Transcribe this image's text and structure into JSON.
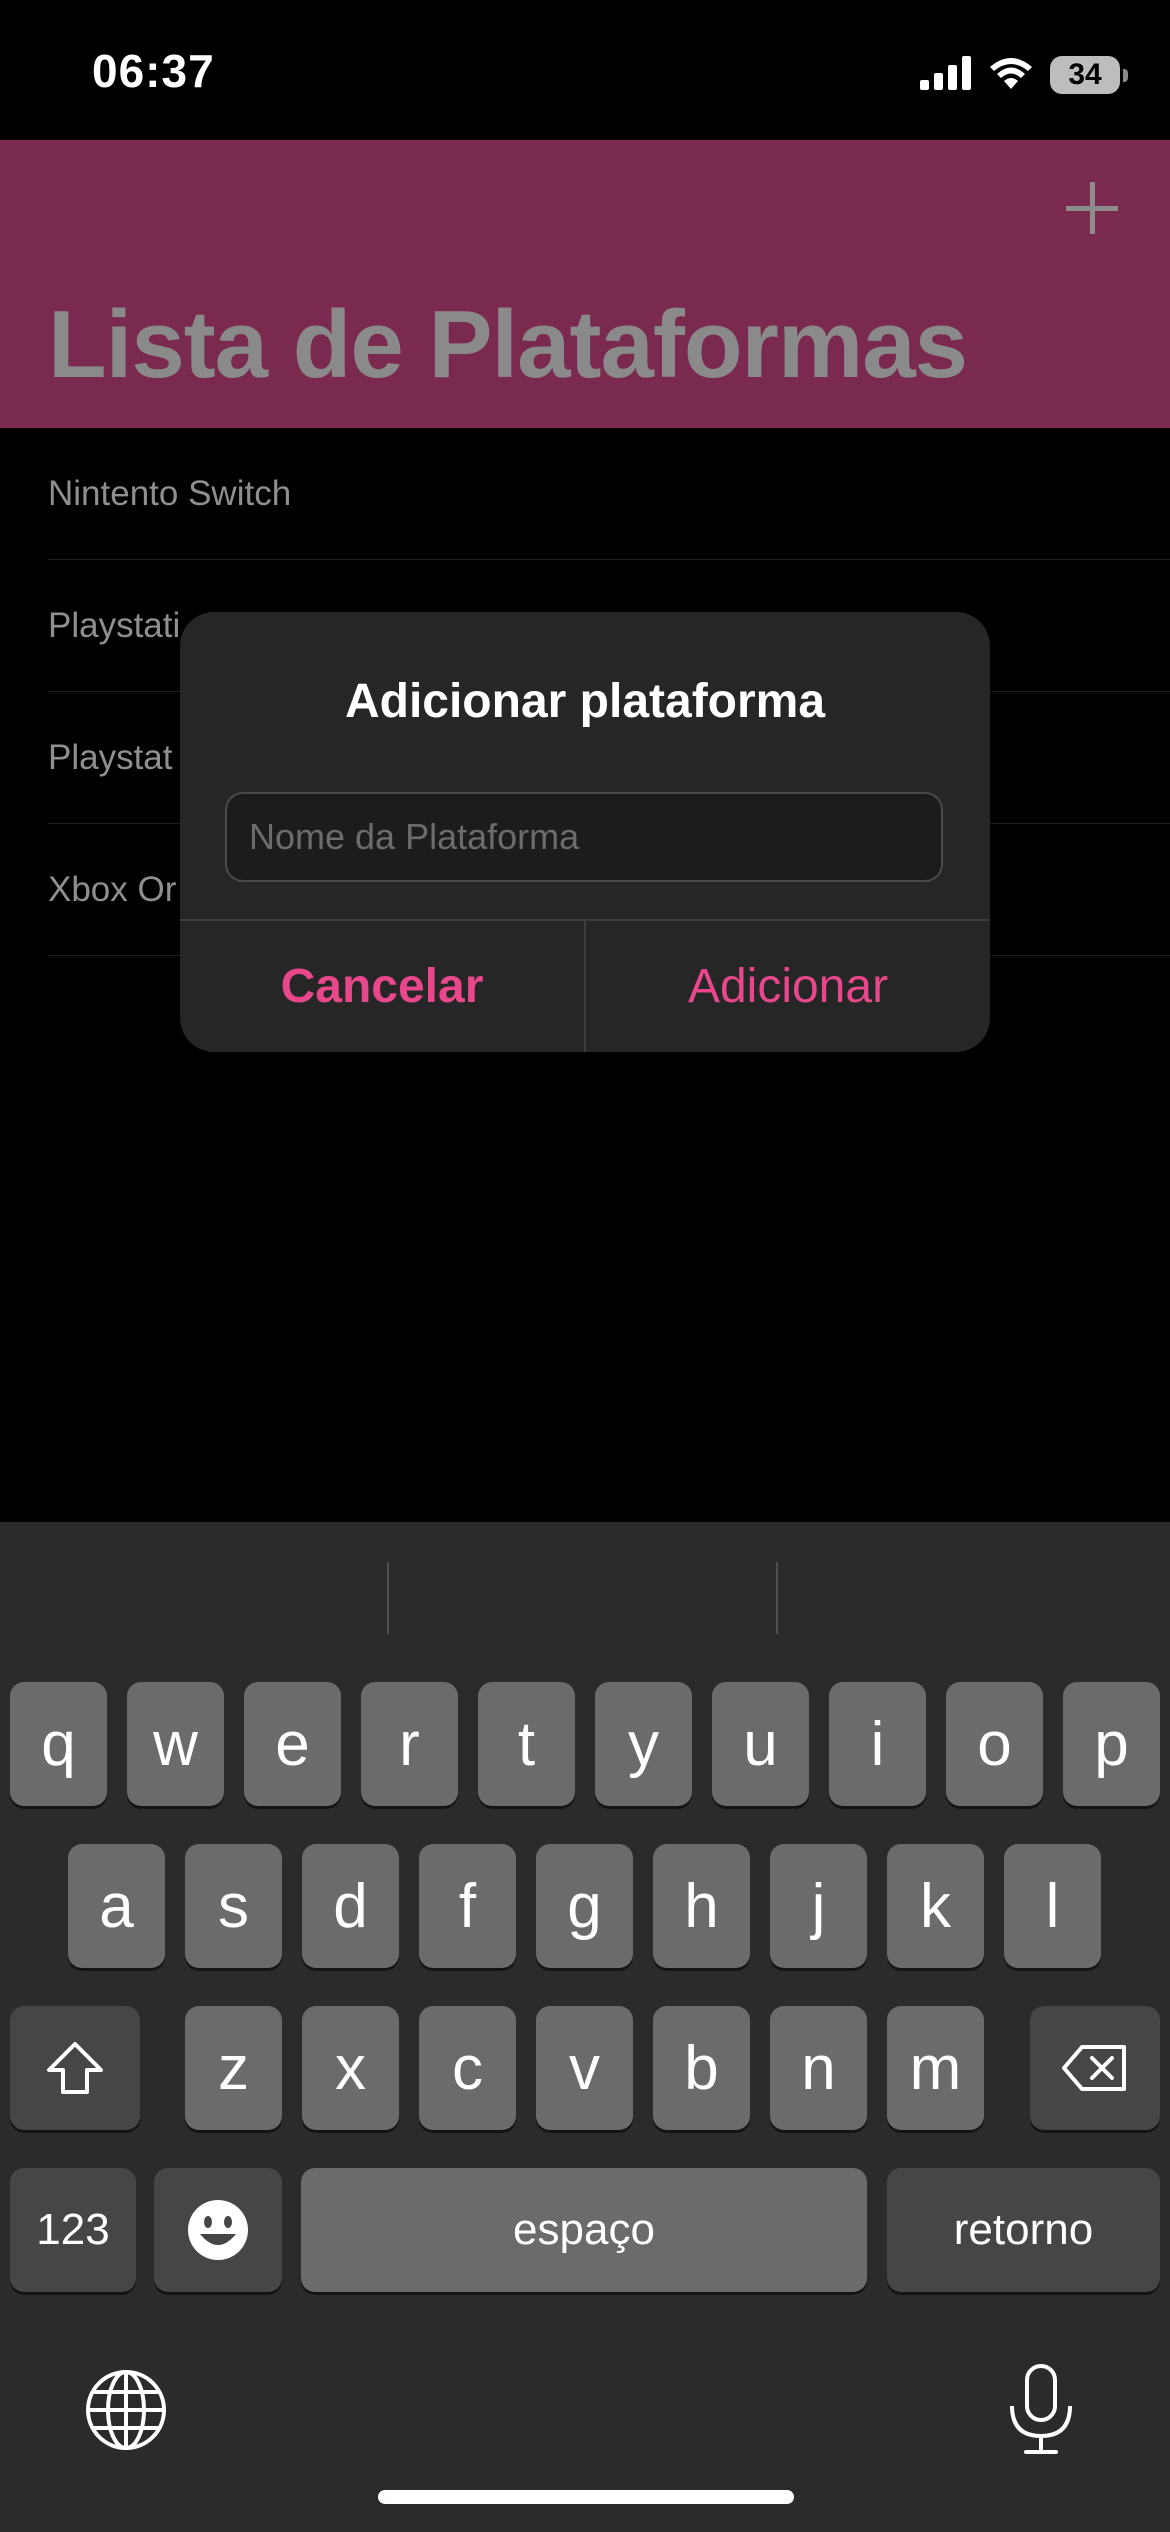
{
  "status_bar": {
    "time": "06:37",
    "battery": "34",
    "icons": [
      "cellular-signal-icon",
      "wifi-icon",
      "battery-icon"
    ]
  },
  "header": {
    "title": "Lista de Plataformas",
    "add_icon": "plus-icon"
  },
  "platforms": [
    {
      "label": "Nintento Switch"
    },
    {
      "label": "Playstati"
    },
    {
      "label": "Playstat"
    },
    {
      "label": "Xbox Or"
    }
  ],
  "alert": {
    "title": "Adicionar plataforma",
    "input_placeholder": "Nome da Plataforma",
    "input_value": "",
    "cancel_label": "Cancelar",
    "confirm_label": "Adicionar"
  },
  "keyboard": {
    "row1": [
      "q",
      "w",
      "e",
      "r",
      "t",
      "y",
      "u",
      "i",
      "o",
      "p"
    ],
    "row2": [
      "a",
      "s",
      "d",
      "f",
      "g",
      "h",
      "j",
      "k",
      "l"
    ],
    "row3": [
      "z",
      "x",
      "c",
      "v",
      "b",
      "n",
      "m"
    ],
    "numbers_label": "123",
    "space_label": "espaço",
    "return_label": "retorno",
    "icons": [
      "shift-icon",
      "delete-icon",
      "emoji-icon",
      "globe-icon",
      "microphone-icon"
    ]
  },
  "colors": {
    "accent": "#e8488b",
    "header_bg": "#7b2a4f",
    "background": "#000000",
    "alert_bg": "#262626",
    "keyboard_bg": "#2b2b2b",
    "key_bg": "#6b6b6b",
    "key_dark_bg": "#464646"
  }
}
